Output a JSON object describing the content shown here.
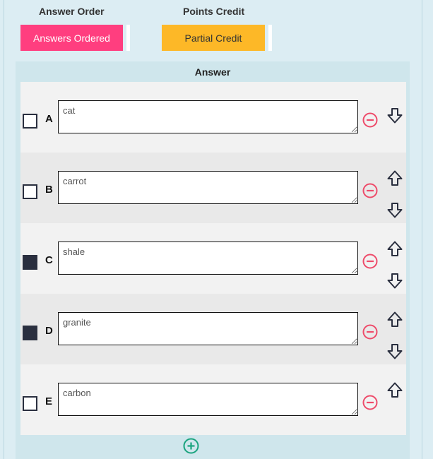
{
  "header": {
    "answer_order_label": "Answer Order",
    "points_credit_label": "Points Credit",
    "answer_order_button": "Answers Ordered",
    "points_credit_button": "Partial Credit"
  },
  "colors": {
    "answers_ordered_bg": "#ff3e7f",
    "partial_credit_bg": "#fdb827",
    "remove_icon": "#ee4b6a",
    "add_icon": "#1aa37e",
    "arrow_icon": "#2a2f3f"
  },
  "answers": {
    "title": "Answer",
    "rows": [
      {
        "letter": "A",
        "value": "cat",
        "checked": false,
        "icons": [
          "minus-circle-icon",
          "arrow-down-icon"
        ]
      },
      {
        "letter": "B",
        "value": "carrot",
        "checked": false,
        "icons": [
          "minus-circle-icon",
          "arrow-up-icon",
          "arrow-down-icon"
        ]
      },
      {
        "letter": "C",
        "value": "shale",
        "checked": true,
        "icons": [
          "minus-circle-icon",
          "arrow-up-icon",
          "arrow-down-icon"
        ]
      },
      {
        "letter": "D",
        "value": "granite",
        "checked": true,
        "icons": [
          "minus-circle-icon",
          "arrow-up-icon",
          "arrow-down-icon"
        ]
      },
      {
        "letter": "E",
        "value": "carbon",
        "checked": false,
        "icons": [
          "minus-circle-icon",
          "arrow-up-icon"
        ]
      }
    ],
    "add_icon": "plus-circle-icon"
  }
}
